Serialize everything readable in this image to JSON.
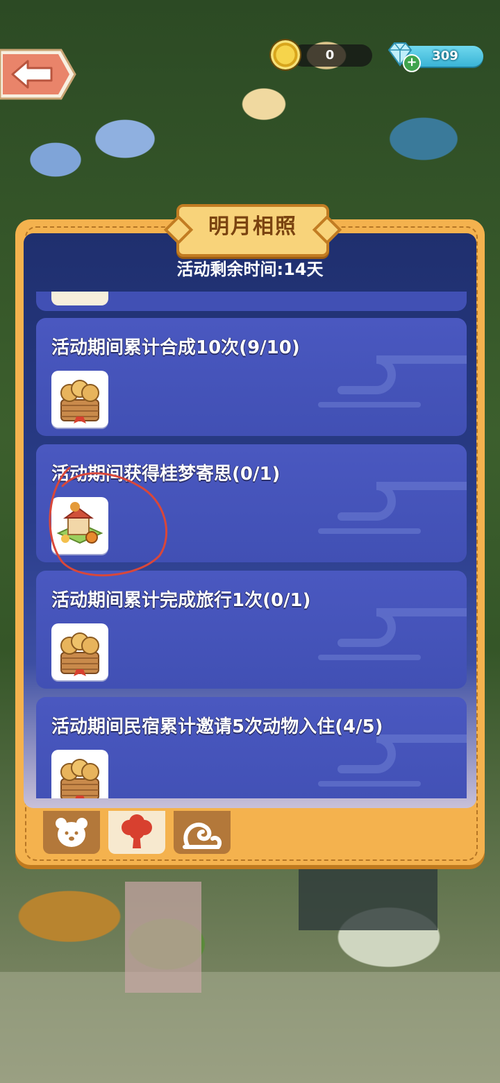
{
  "hud": {
    "coins": "0",
    "gems": "309",
    "gem_plus": "+"
  },
  "panel": {
    "title": "明月相照",
    "remaining_time": "活动剩余时间:14天"
  },
  "tasks": [
    {
      "label": "活动期间累计合成10次(9/10)",
      "reward_icon": "mooncake-basket-icon"
    },
    {
      "label": "活动期间获得桂梦寄思(0/1)",
      "reward_icon": "osmanthus-dream-decoration-icon"
    },
    {
      "label": "活动期间累计完成旅行1次(0/1)",
      "reward_icon": "mooncake-basket-icon"
    },
    {
      "label": "活动期间民宿累计邀请5次动物入住(4/5)",
      "reward_icon": "mooncake-basket-icon"
    }
  ],
  "tabs": [
    {
      "icon": "bear-face-icon",
      "active": false
    },
    {
      "icon": "tree-icon",
      "active": true
    },
    {
      "icon": "swirl-cloud-icon",
      "active": false
    }
  ],
  "colors": {
    "panel_frame": "#f4b24e",
    "task_card": "#4150b4",
    "title_text": "#7a4310",
    "annotation": "#d9473a"
  }
}
